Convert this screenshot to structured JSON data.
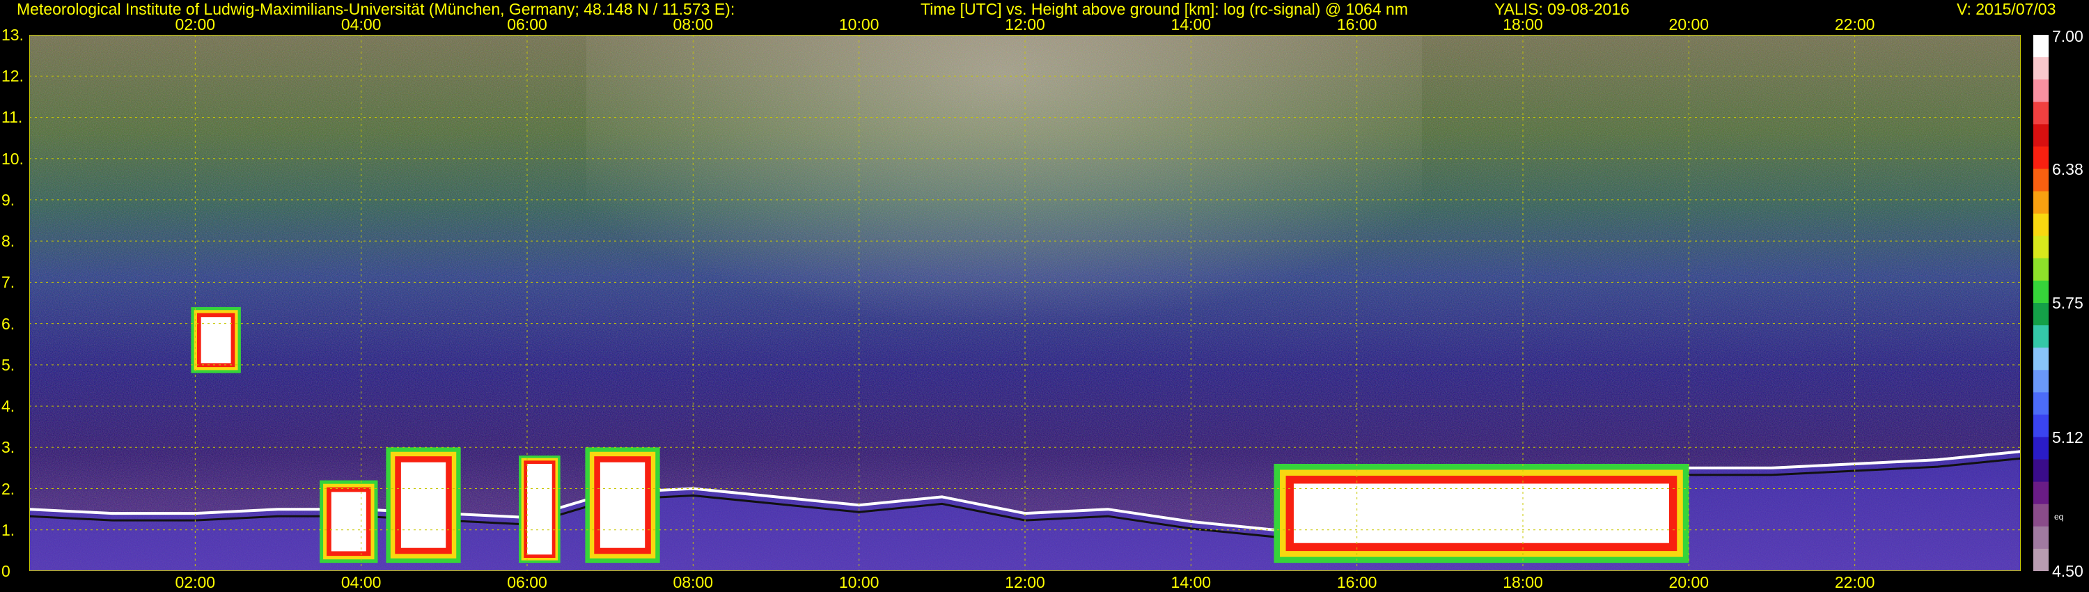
{
  "header": {
    "institute": "Meteorological Institute of Ludwig-Maximilians-Universität (München, Germany; 48.148 N / 11.573 E):",
    "plot_title": "Time [UTC] vs. Height above ground [km]: log (rc-signal) @ 1064 nm",
    "instrument_date": "YALIS: 09-08-2016",
    "version": "V: 2015/07/03"
  },
  "colors": {
    "text": "#ffff00",
    "grid": "#c8c800",
    "background": "#000000"
  },
  "colorbar": {
    "tick_labels": [
      "7.00",
      "6.38",
      "5.75",
      "5.12",
      "4.50"
    ],
    "unit_label": "eq",
    "min": 4.5,
    "max": 7.0,
    "colors": [
      "#b89cb0",
      "#a07aa0",
      "#8a4c8a",
      "#6a1c86",
      "#3a0c8a",
      "#2a1cc8",
      "#3a44f0",
      "#4c6cf8",
      "#6a98f8",
      "#88c4f8",
      "#34c8a8",
      "#14a048",
      "#36d43a",
      "#8ee02a",
      "#d8e81c",
      "#f8d810",
      "#f8a010",
      "#f86010",
      "#f82010",
      "#d81010",
      "#f04040",
      "#f890a0",
      "#f8c8cc",
      "#ffffff"
    ]
  },
  "chart_data": {
    "type": "heatmap",
    "title": "Time [UTC] vs. Height above ground [km]: log (rc-signal) @ 1064 nm",
    "xlabel": "Time [UTC]",
    "ylabel": "Height above ground [km]",
    "x_range": [
      "00:00",
      "24:00"
    ],
    "y_range": [
      0,
      13
    ],
    "x_ticks": [
      "02:00",
      "04:00",
      "06:00",
      "08:00",
      "10:00",
      "12:00",
      "14:00",
      "16:00",
      "18:00",
      "20:00",
      "22:00"
    ],
    "y_ticks": [
      "0",
      "1.",
      "2.",
      "3.",
      "4.",
      "5.",
      "6.",
      "7.",
      "8.",
      "9.",
      "10.",
      "11.",
      "12.",
      "13."
    ],
    "color_range": [
      4.5,
      7.0
    ],
    "grid": true,
    "features": [
      {
        "name": "boundary-layer-top",
        "points": [
          [
            0.0,
            1.5
          ],
          [
            1.0,
            1.4
          ],
          [
            2.0,
            1.4
          ],
          [
            3.0,
            1.5
          ],
          [
            4.0,
            1.5
          ],
          [
            5.0,
            1.4
          ],
          [
            6.0,
            1.3
          ],
          [
            7.0,
            1.9
          ],
          [
            8.0,
            2.0
          ],
          [
            9.0,
            1.8
          ],
          [
            10.0,
            1.6
          ],
          [
            11.0,
            1.8
          ],
          [
            12.0,
            1.4
          ],
          [
            13.0,
            1.5
          ],
          [
            14.0,
            1.2
          ],
          [
            15.0,
            1.0
          ],
          [
            16.0,
            2.2
          ],
          [
            17.0,
            2.3
          ],
          [
            18.0,
            2.4
          ],
          [
            19.0,
            2.4
          ],
          [
            20.0,
            2.5
          ],
          [
            21.0,
            2.5
          ],
          [
            22.0,
            2.6
          ],
          [
            23.0,
            2.7
          ],
          [
            24.0,
            2.9
          ]
        ]
      },
      {
        "name": "elevated-cloud",
        "t_start": 1.95,
        "t_end": 2.55,
        "h_min": 4.8,
        "h_max": 6.4
      },
      {
        "name": "low-cloud",
        "t_start": 3.5,
        "t_end": 4.2,
        "h_min": 0.2,
        "h_max": 2.2
      },
      {
        "name": "low-cloud",
        "t_start": 4.3,
        "t_end": 5.2,
        "h_min": 0.2,
        "h_max": 3.0
      },
      {
        "name": "low-cloud",
        "t_start": 5.9,
        "t_end": 6.4,
        "h_min": 0.2,
        "h_max": 2.8
      },
      {
        "name": "low-cloud",
        "t_start": 6.7,
        "t_end": 7.6,
        "h_min": 0.2,
        "h_max": 3.0
      },
      {
        "name": "low-cloud",
        "t_start": 15.0,
        "t_end": 20.0,
        "h_min": 0.2,
        "h_max": 2.6
      }
    ]
  }
}
